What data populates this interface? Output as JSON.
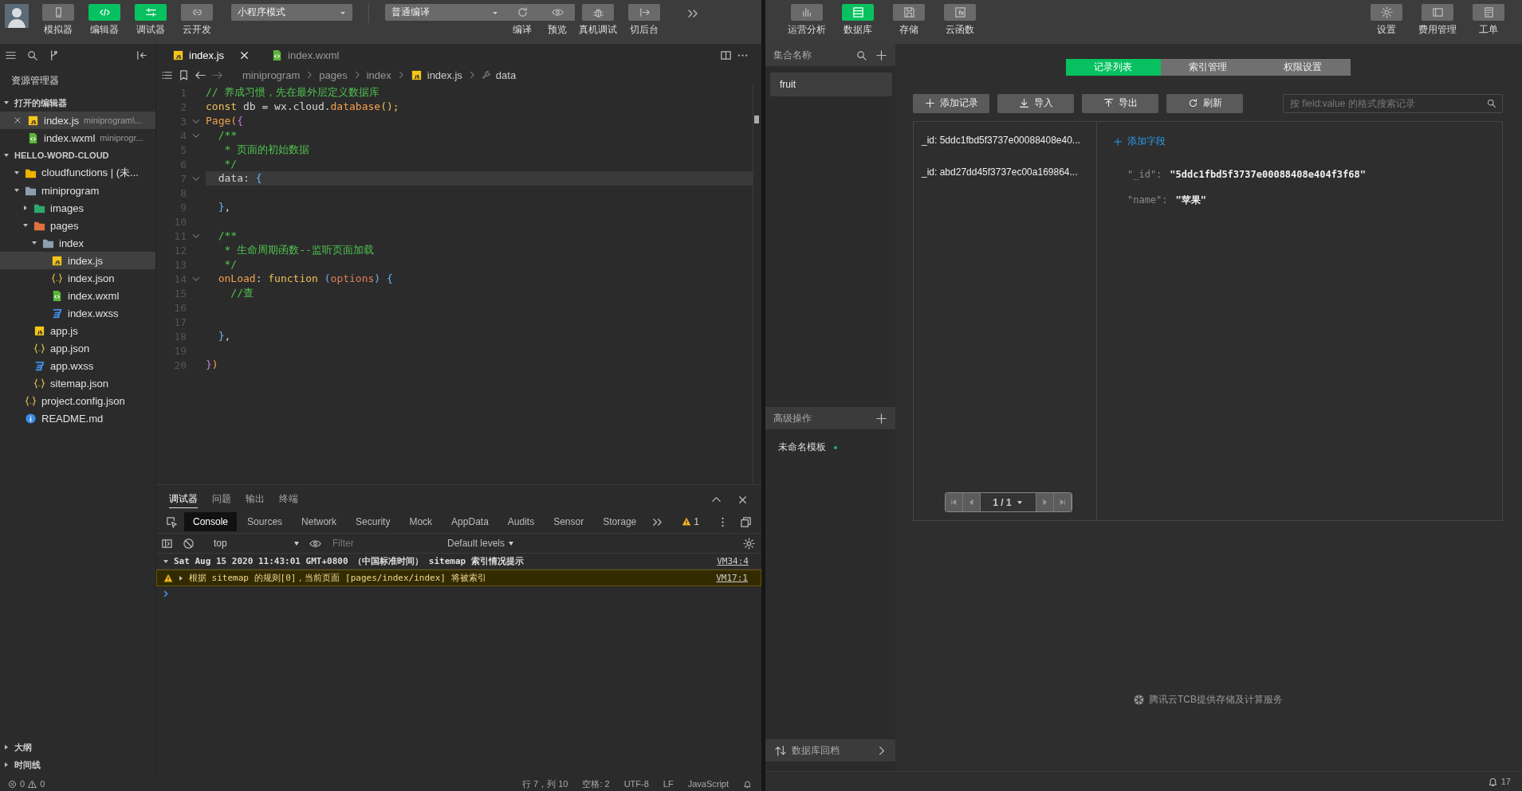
{
  "toolbar": {
    "buttons": [
      {
        "label": "模拟器",
        "on": false
      },
      {
        "label": "编辑器",
        "on": true
      },
      {
        "label": "调试器",
        "on": true
      },
      {
        "label": "云开发",
        "on": false
      }
    ],
    "mode_select": "小程序模式",
    "compile_select": "普通编译",
    "actions": [
      {
        "label": "编译",
        "kind": "inline"
      },
      {
        "label": "预览",
        "kind": "inline"
      },
      {
        "label": "真机调试",
        "kind": "button"
      },
      {
        "label": "切后台",
        "kind": "button"
      }
    ]
  },
  "sidebar": {
    "title": "资源管理器",
    "open_editors": {
      "title": "打开的编辑器",
      "expanded": true,
      "items": [
        {
          "name": "index.js",
          "path": "miniprogram\\...",
          "kind": "js",
          "selected": true
        },
        {
          "name": "index.wxml",
          "path": "miniprogr...",
          "kind": "wxml",
          "selected": false
        }
      ]
    },
    "project": {
      "title": "HELLO-WORD-CLOUD",
      "expanded": true,
      "items": [
        {
          "kind": "cloud-folder",
          "name": "cloudfunctions | (未...",
          "expanded": true,
          "selected": false
        },
        {
          "kind": "folder",
          "name": "miniprogram",
          "expanded": true,
          "selected": false,
          "children": [
            {
              "kind": "image-folder",
              "name": "images",
              "expanded": false,
              "selected": false
            },
            {
              "kind": "pages-folder",
              "name": "pages",
              "expanded": true,
              "selected": false,
              "children": [
                {
                  "kind": "folder",
                  "name": "index",
                  "expanded": true,
                  "selected": false,
                  "children": [
                    {
                      "kind": "js",
                      "name": "index.js",
                      "selected": true
                    },
                    {
                      "kind": "json",
                      "name": "index.json",
                      "selected": false
                    },
                    {
                      "kind": "wxml",
                      "name": "index.wxml",
                      "selected": false
                    },
                    {
                      "kind": "wxss",
                      "name": "index.wxss",
                      "selected": false
                    }
                  ]
                }
              ]
            },
            {
              "kind": "js",
              "name": "app.js",
              "selected": false
            },
            {
              "kind": "json",
              "name": "app.json",
              "selected": false
            },
            {
              "kind": "wxss",
              "name": "app.wxss",
              "selected": false
            },
            {
              "kind": "json",
              "name": "sitemap.json",
              "selected": false
            }
          ]
        },
        {
          "kind": "json",
          "name": "project.config.json",
          "selected": false
        },
        {
          "kind": "info",
          "name": "README.md",
          "selected": false
        }
      ]
    },
    "bottom_sections": [
      {
        "title": "大纲",
        "expanded": false
      },
      {
        "title": "时间线",
        "expanded": false
      }
    ]
  },
  "editor": {
    "tabs": [
      {
        "name": "index.js",
        "kind": "js",
        "selected": true
      },
      {
        "name": "index.wxml",
        "kind": "wxml",
        "selected": false
      }
    ],
    "breadcrumb": [
      {
        "text": "miniprogram",
        "kind": "folder"
      },
      {
        "text": "pages",
        "kind": "folder"
      },
      {
        "text": "index",
        "kind": "folder"
      },
      {
        "text": "index.js",
        "kind": "js"
      },
      {
        "text": "data",
        "kind": "symbol"
      }
    ],
    "lines": [
      {
        "number": "1",
        "fold": false,
        "selected": false,
        "tokens": [
          {
            "text": "// 养成习惯，先在最外层定义数据库",
            "kind": "comment"
          }
        ]
      },
      {
        "number": "2",
        "fold": false,
        "selected": false,
        "tokens": [
          {
            "text": "const",
            "kind": "keyword"
          },
          {
            "text": " db = wx.cloud.",
            "kind": "plain"
          },
          {
            "text": "database",
            "kind": "func"
          },
          {
            "text": "();",
            "kind": "keyword"
          }
        ]
      },
      {
        "number": "3",
        "fold": true,
        "selected": false,
        "tokens": [
          {
            "text": "Page",
            "kind": "func"
          },
          {
            "text": "(",
            "kind": "func"
          },
          {
            "text": "{",
            "kind": "bracket"
          }
        ]
      },
      {
        "number": "4",
        "fold": true,
        "selected": false,
        "tokens": [
          {
            "text": "  /**",
            "kind": "comment"
          }
        ]
      },
      {
        "number": "5",
        "fold": false,
        "selected": false,
        "tokens": [
          {
            "text": "   * 页面的初始数据",
            "kind": "comment"
          }
        ]
      },
      {
        "number": "6",
        "fold": false,
        "selected": false,
        "tokens": [
          {
            "text": "   */",
            "kind": "comment"
          }
        ]
      },
      {
        "number": "7",
        "fold": true,
        "selected": true,
        "tokens": [
          {
            "text": "  data: ",
            "kind": "plain"
          },
          {
            "text": "{",
            "kind": "brace"
          }
        ]
      },
      {
        "number": "8",
        "fold": false,
        "selected": false
      },
      {
        "number": "9",
        "fold": false,
        "selected": false,
        "tokens": [
          {
            "text": "  }",
            "kind": "brace"
          },
          {
            "text": ",",
            "kind": "plain"
          }
        ]
      },
      {
        "number": "10",
        "fold": false,
        "selected": false
      },
      {
        "number": "11",
        "fold": true,
        "selected": false,
        "tokens": [
          {
            "text": "  /**",
            "kind": "comment"
          }
        ]
      },
      {
        "number": "12",
        "fold": false,
        "selected": false,
        "tokens": [
          {
            "text": "   * 生命周期函数--监听页面加载",
            "kind": "comment"
          }
        ]
      },
      {
        "number": "13",
        "fold": false,
        "selected": false,
        "tokens": [
          {
            "text": "   */",
            "kind": "comment"
          }
        ]
      },
      {
        "number": "14",
        "fold": true,
        "selected": false,
        "tokens": [
          {
            "text": "  onLoad",
            "kind": "func"
          },
          {
            "text": ": ",
            "kind": "plain"
          },
          {
            "text": "function",
            "kind": "keyword"
          },
          {
            "text": " (",
            "kind": "brace"
          },
          {
            "text": "options",
            "kind": "param"
          },
          {
            "text": ") {",
            "kind": "brace"
          }
        ]
      },
      {
        "number": "15",
        "fold": false,
        "selected": false,
        "tokens": [
          {
            "text": "    //查",
            "kind": "comment"
          }
        ]
      },
      {
        "number": "16",
        "fold": false,
        "selected": false
      },
      {
        "number": "17",
        "fold": false,
        "selected": false
      },
      {
        "number": "18",
        "fold": false,
        "selected": false,
        "tokens": [
          {
            "text": "  }",
            "kind": "brace"
          },
          {
            "text": ",",
            "kind": "plain"
          }
        ]
      },
      {
        "number": "19",
        "fold": false,
        "selected": false
      },
      {
        "number": "20",
        "fold": false,
        "selected": false,
        "tokens": [
          {
            "text": "}",
            "kind": "bracket"
          },
          {
            "text": ")",
            "kind": "func"
          }
        ]
      }
    ]
  },
  "debugger": {
    "tabs": [
      {
        "label": "调试器",
        "selected": true
      },
      {
        "label": "问题",
        "selected": false
      },
      {
        "label": "输出",
        "selected": false
      },
      {
        "label": "终端",
        "selected": false
      }
    ],
    "devtools_tabs": [
      {
        "label": "Console",
        "selected": true
      },
      {
        "label": "Sources",
        "selected": false
      },
      {
        "label": "Network",
        "selected": false
      },
      {
        "label": "Security",
        "selected": false
      },
      {
        "label": "Mock",
        "selected": false
      },
      {
        "label": "AppData",
        "selected": false
      },
      {
        "label": "Audits",
        "selected": false
      },
      {
        "label": "Sensor",
        "selected": false
      },
      {
        "label": "Storage",
        "selected": false
      }
    ],
    "warning_count": "1",
    "context": "top",
    "filter_placeholder": "Filter",
    "levels": "Default levels",
    "log": [
      {
        "kind": "group",
        "expanded": true,
        "text": "Sat Aug 15 2020 11:43:01 GMT+0800 （中国标准时间） sitemap 索引情况提示",
        "source": "VM34:4"
      },
      {
        "kind": "warning",
        "expanded": false,
        "text": "根据 sitemap 的规则[0]，当前页面 [pages/index/index] 将被索引",
        "source": "VM17:1"
      }
    ]
  },
  "status_bar": {
    "errors": "0",
    "warnings": "0",
    "items": [
      "行 7，列 10",
      "空格: 2",
      "UTF-8",
      "LF",
      "JavaScript"
    ]
  },
  "cloud": {
    "toolbar_left": [
      {
        "label": "运营分析",
        "selected": false
      },
      {
        "label": "数据库",
        "selected": true
      },
      {
        "label": "存储",
        "selected": false
      },
      {
        "label": "云函数",
        "selected": false
      }
    ],
    "toolbar_right": [
      {
        "label": "设置",
        "selected": false
      },
      {
        "label": "费用管理",
        "selected": false
      },
      {
        "label": "工单",
        "selected": false
      }
    ],
    "collections": {
      "header": "集合名称",
      "items": [
        {
          "name": "fruit",
          "selected": true
        }
      ]
    },
    "advanced": {
      "header": "高级操作",
      "items": [
        {
          "name": "未命名模板",
          "color": "#07c160"
        }
      ]
    },
    "rollback": "数据库回档",
    "tabs": [
      {
        "label": "记录列表",
        "selected": true
      },
      {
        "label": "索引管理",
        "selected": false
      },
      {
        "label": "权限设置",
        "selected": false
      }
    ],
    "actions": [
      {
        "label": "添加记录"
      },
      {
        "label": "导入"
      },
      {
        "label": "导出"
      },
      {
        "label": "刷新"
      }
    ],
    "search_placeholder": "按 field:value 的格式搜索记录",
    "records": [
      "_id: 5ddc1fbd5f3737e00088408e40...",
      "_id: abd27dd45f3737ec00a169864..."
    ],
    "pagination": "1 / 1",
    "add_field": "添加字段",
    "fields": [
      {
        "key": "\"_id\":",
        "value": "\"5ddc1fbd5f3737e00088408e404f3f68\""
      },
      {
        "key": "\"name\":",
        "value": "\"苹果\""
      }
    ],
    "footer": "腾讯云TCB提供存储及计算服务",
    "notifications": "17"
  }
}
